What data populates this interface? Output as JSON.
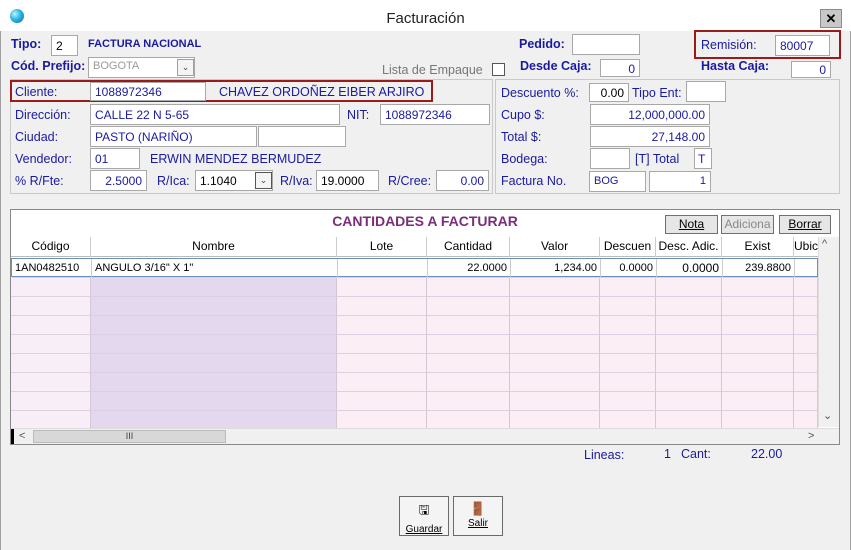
{
  "window": {
    "title": "Facturación",
    "close_glyph": "✕"
  },
  "header": {
    "tipo_label": "Tipo:",
    "tipo_value": "2",
    "tipo_desc": "FACTURA NACIONAL",
    "pedido_label": "Pedido:",
    "pedido_value": "",
    "remision_label": "Remisión:",
    "remision_value": "80007",
    "cod_prefijo_label": "Cód. Prefijo:",
    "cod_prefijo_value": "BOGOTA",
    "lista_empaque_label": "Lista de Empaque",
    "desde_caja_label": "Desde Caja:",
    "desde_caja_value": "0",
    "hasta_caja_label": "Hasta Caja:",
    "hasta_caja_value": "0"
  },
  "cliente": {
    "cliente_label": "Cliente:",
    "cliente_id": "1088972346",
    "cliente_nombre": "CHAVEZ ORDOÑEZ EIBER ARJIRO",
    "direccion_label": "Dirección:",
    "direccion_value": "CALLE 22 N 5-65",
    "nit_label": "NIT:",
    "nit_value": "1088972346",
    "ciudad_label": "Ciudad:",
    "ciudad_value": "PASTO (NARIÑO)",
    "ciudad_extra": "",
    "vendedor_label": "Vendedor:",
    "vendedor_code": "01",
    "vendedor_name": "ERWIN MENDEZ BERMUDEZ",
    "rfte_label": "% R/Fte:",
    "rfte_value": "2.5000",
    "rica_label": "R/Ica:",
    "rica_value": "1.1040",
    "riva_label": "R/Iva:",
    "riva_value": "19.0000",
    "rcree_label": "R/Cree:",
    "rcree_value": "0.00"
  },
  "totales": {
    "descuento_label": "Descuento %:",
    "descuento_value": "0.00",
    "tipo_ent_label": "Tipo Ent:",
    "tipo_ent_value": "",
    "cupo_label": "Cupo $:",
    "cupo_value": "12,000,000.00",
    "total_label": "Total $:",
    "total_value": "27,148.00",
    "bodega_label": "Bodega:",
    "bodega_value": "",
    "bodega_total_label": "[T] Total",
    "bodega_t": "T",
    "factura_label": "Factura No.",
    "factura_prefijo": "BOG",
    "factura_numero": "1"
  },
  "grid": {
    "title": "CANTIDADES A FACTURAR",
    "buttons": {
      "nota": "Nota",
      "adiciona": "Adiciona",
      "borrar": "Borrar"
    },
    "columns": [
      "Código",
      "Nombre",
      "Lote",
      "Cantidad",
      "Valor",
      "Descuen",
      "Desc. Adic.",
      "Exist",
      "Ubic"
    ],
    "rows": [
      {
        "codigo": "1AN0482510",
        "nombre": "ANGULO 3/16\" X 1\"",
        "lote": "",
        "cantidad": "22.0000",
        "valor": "1,234.00",
        "descuento": "0.0000",
        "desc_adic": "0.0000",
        "exist": "239.8800",
        "ubic": ""
      }
    ],
    "scroll_h_thumb": "III"
  },
  "footer": {
    "lineas_label": "Lineas:",
    "lineas_value": "1",
    "cant_label": "Cant:",
    "cant_value": "22.00"
  },
  "actions": {
    "guardar": "Guardar",
    "salir": "Salir"
  }
}
